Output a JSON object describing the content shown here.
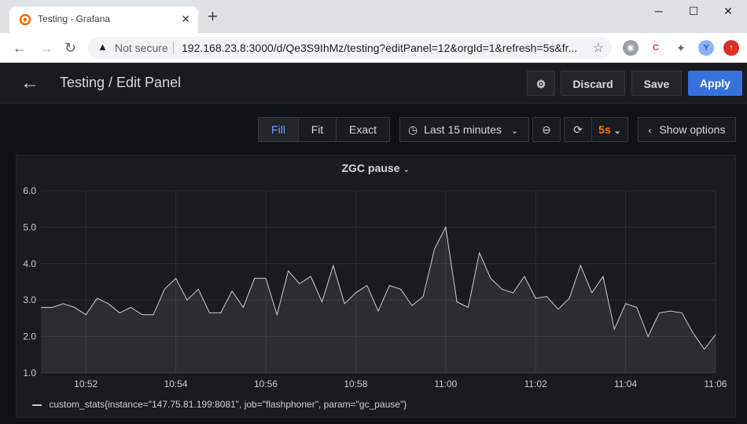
{
  "browser": {
    "tab_title": "Testing - Grafana",
    "tab_close": "✕",
    "new_tab": "+",
    "not_secure": "Not secure",
    "url": "192.168.23.8:3000/d/Qe3S9IhMz/testing?editPanel=12&orgId=1&refresh=5s&fr...",
    "profile_initial": "Y",
    "win_minimize": "─",
    "win_maximize": "☐",
    "win_close": "✕"
  },
  "header": {
    "title": "Testing / Edit Panel",
    "discard": "Discard",
    "save": "Save",
    "apply": "Apply"
  },
  "toolbar": {
    "fill": "Fill",
    "fit": "Fit",
    "exact": "Exact",
    "time_range": "Last 15 minutes",
    "refresh_interval": "5s",
    "show_options": "Show options"
  },
  "panel": {
    "title": "ZGC pause"
  },
  "colors": {
    "accent": "#3871dc",
    "refresh_orange": "#ff780a",
    "series": "#ccccdc"
  },
  "chart_data": {
    "type": "area",
    "title": "ZGC pause",
    "ylim": [
      1.0,
      6.0
    ],
    "y_ticks": [
      "1.0",
      "2.0",
      "3.0",
      "4.0",
      "5.0",
      "6.0"
    ],
    "x_tick_labels": [
      "10:52",
      "10:54",
      "10:56",
      "10:58",
      "11:00",
      "11:02",
      "11:04",
      "11:06"
    ],
    "x_tick_minutes": [
      1,
      3,
      5,
      7,
      9,
      11,
      13,
      15
    ],
    "xlim_minutes": [
      0,
      15
    ],
    "grid": true,
    "legend_position": "bottom-left",
    "series": [
      {
        "name": "custom_stats{instance=\"147.75.81.199:8081\", job=\"flashphoner\", param=\"gc_pause\"}",
        "x_minutes": [
          0.0,
          0.25,
          0.5,
          0.75,
          1.0,
          1.25,
          1.5,
          1.75,
          2.0,
          2.25,
          2.5,
          2.75,
          3.0,
          3.25,
          3.5,
          3.75,
          4.0,
          4.25,
          4.5,
          4.75,
          5.0,
          5.25,
          5.5,
          5.75,
          6.0,
          6.25,
          6.5,
          6.75,
          7.0,
          7.25,
          7.5,
          7.75,
          8.0,
          8.25,
          8.5,
          8.75,
          9.0,
          9.25,
          9.5,
          9.75,
          10.0,
          10.25,
          10.5,
          10.75,
          11.0,
          11.25,
          11.5,
          11.75,
          12.0,
          12.25,
          12.5,
          12.75,
          13.0,
          13.25,
          13.5,
          13.75,
          14.0,
          14.25,
          14.5,
          14.75,
          15.0
        ],
        "values": [
          2.8,
          2.8,
          2.9,
          2.8,
          2.6,
          3.05,
          2.9,
          2.65,
          2.8,
          2.6,
          2.6,
          3.3,
          3.6,
          3.0,
          3.3,
          2.65,
          2.65,
          3.25,
          2.8,
          3.6,
          3.6,
          2.6,
          3.8,
          3.45,
          3.65,
          2.95,
          3.95,
          2.9,
          3.2,
          3.4,
          2.7,
          3.4,
          3.3,
          2.85,
          3.1,
          4.4,
          5.0,
          2.95,
          2.8,
          4.3,
          3.6,
          3.3,
          3.2,
          3.65,
          3.05,
          3.1,
          2.75,
          3.05,
          3.95,
          3.2,
          3.65,
          2.2,
          2.9,
          2.8,
          2.0,
          2.65,
          2.7,
          2.65,
          2.1,
          1.65,
          2.05
        ]
      }
    ]
  }
}
